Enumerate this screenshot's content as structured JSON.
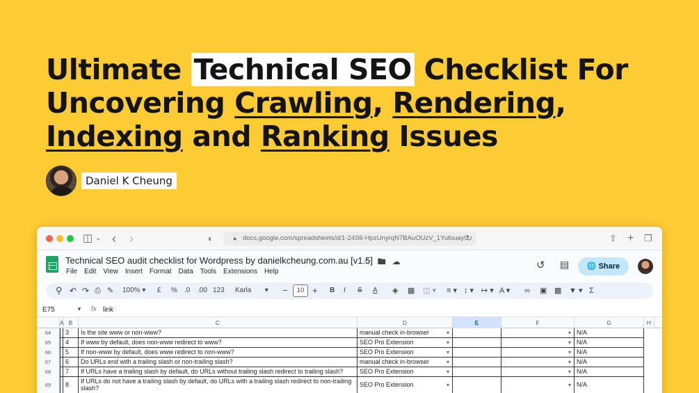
{
  "headline": {
    "line1_a": "Ultimate ",
    "line1_hl": "Technical SEO",
    "line1_b": " Checklist For",
    "line2_a": "Uncovering ",
    "line2_crawling": "Crawling",
    "line2_comma1": ", ",
    "line2_rendering": "Rendering",
    "line2_comma2": ",",
    "line3_indexing": "Indexing",
    "line3_and": " and ",
    "line3_ranking": "Ranking",
    "line3_issues": " Issues"
  },
  "author": {
    "name": "Daniel K Cheung"
  },
  "browser": {
    "url": "docs.google.com/spreadsheets/d/1-24S6-HpzUnyrqN7BAuOUzV_1Yufouay0",
    "icons": {
      "sidebar": "sidebar-icon",
      "back": "chevron-left-icon",
      "forward": "chevron-right-icon",
      "shield": "shield-icon",
      "share": "share-icon",
      "new_tab": "plus-icon",
      "tabs": "tabs-icon"
    }
  },
  "sheet": {
    "title": "Technical SEO audit checklist for Wordpress by danielkcheung.com.au [v1.5]",
    "menu": [
      "File",
      "Edit",
      "View",
      "Insert",
      "Format",
      "Data",
      "Tools",
      "Extensions",
      "Help"
    ],
    "share_label": "Share",
    "toolbar": {
      "zoom": "100%",
      "currency": "£",
      "percent": "%",
      "dec_less": ".0",
      "dec_more": ".00",
      "number_fmt": "123",
      "font": "Karla",
      "font_size": "10"
    },
    "cell_ref": "E75",
    "formula_value": "link",
    "columns": [
      "A",
      "B",
      "C",
      "D",
      "E",
      "F",
      "G",
      "H"
    ],
    "rows": [
      {
        "num": "64",
        "b": "3",
        "c": "Is the site www or non-www?",
        "d": "manual check in-browser",
        "g": "N/A"
      },
      {
        "num": "65",
        "b": "4",
        "c": "If www by default, does non-www redirect to www?",
        "d": "SEO Pro Extension",
        "g": "N/A"
      },
      {
        "num": "66",
        "b": "5",
        "c": "If non-www by default, does www redirect to non-www?",
        "d": "SEO Pro Extension",
        "g": "N/A"
      },
      {
        "num": "67",
        "b": "6",
        "c": "Do URLs end with a trailing slash or non-trailing slash?",
        "d": "manual check in-browser",
        "g": "N/A"
      },
      {
        "num": "68",
        "b": "7",
        "c": "If URLs have a trailing slash by default, do URLs without trailing slash redirect to trailing slash?",
        "d": "SEO Pro Extension",
        "g": "N/A"
      },
      {
        "num": "69",
        "b": "8",
        "c": "If URLs do not have a trailing slash by default, do URLs with a trailing slash redirect to non-trailing slash?",
        "d": "SEO Pro Extension",
        "g": "N/A"
      }
    ]
  },
  "colors": {
    "background": "#fdcb33",
    "share_button": "#c2e7ff",
    "sheets_green": "#1fa463",
    "selected_col": "#d3e3fd"
  }
}
